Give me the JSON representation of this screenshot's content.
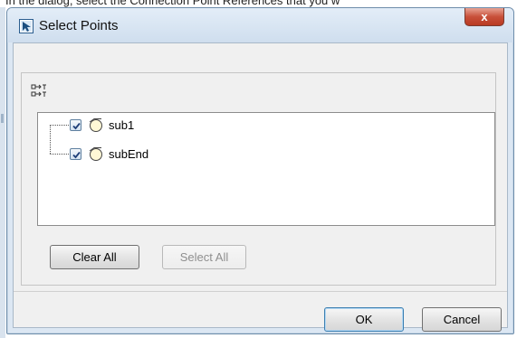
{
  "top_caption": "In the dialog, select the Connection Point References that you w",
  "dialog": {
    "title": "Select Points",
    "close_label": "x"
  },
  "tree": {
    "items": [
      {
        "label": "sub1",
        "checked": true
      },
      {
        "label": "subEnd",
        "checked": true
      }
    ]
  },
  "buttons": {
    "clear_all": "Clear All",
    "select_all": "Select All",
    "ok": "OK",
    "cancel": "Cancel"
  },
  "colors": {
    "titlebar": "#dce7f3",
    "close": "#c8503a",
    "content_bg": "#f0f0f0"
  }
}
